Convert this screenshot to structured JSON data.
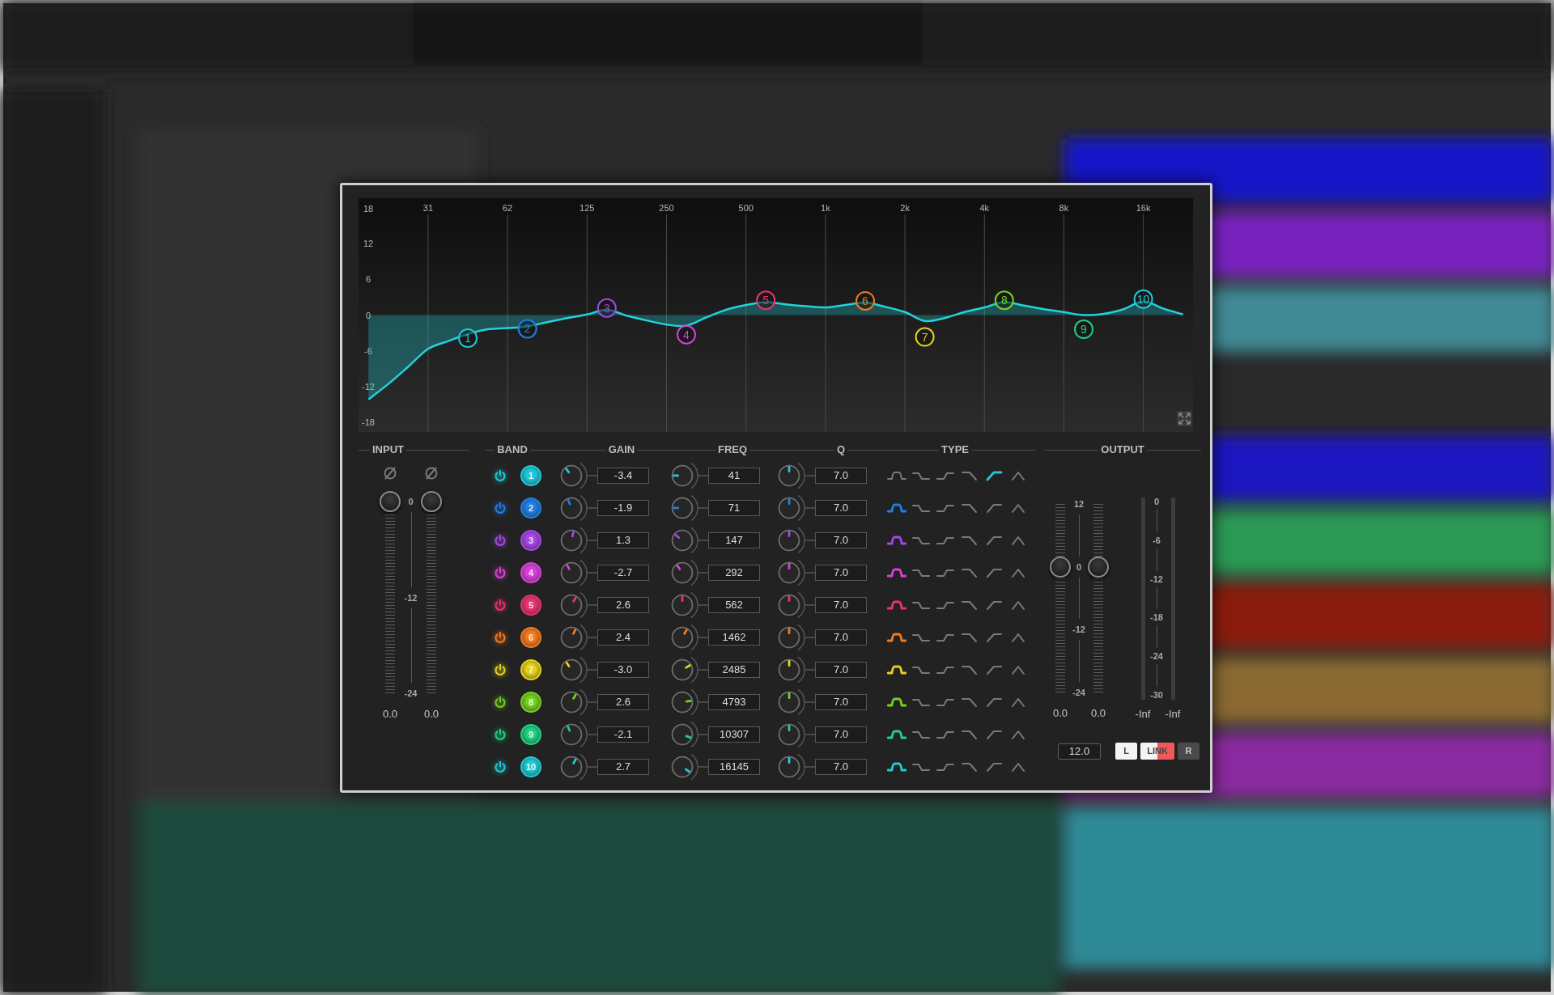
{
  "eq_graph": {
    "chart_data": {
      "type": "area",
      "grid": true,
      "categories": [
        null,
        null,
        null,
        "31",
        null,
        null,
        null,
        "62",
        null,
        null,
        null,
        "125",
        null,
        null,
        null,
        "250",
        null,
        null,
        null,
        "500",
        null,
        null,
        null,
        "1k",
        null,
        null,
        null,
        "2k",
        null,
        null,
        null,
        "4k",
        null,
        null,
        null,
        "8k",
        null,
        null,
        null,
        "16k",
        null,
        null
      ],
      "yticks": [
        18,
        12,
        6,
        0,
        -6,
        -12,
        -18
      ],
      "ylim": [
        -19.7,
        19.7
      ],
      "series": [
        {
          "color": "#22d3dc",
          "values": [
            -14.2,
            -11.6,
            -8.7,
            -5.7,
            -4.4,
            -3.2,
            -2.4,
            -2.2,
            -1.9,
            -1.2,
            -0.5,
            0.1,
            0.9,
            -0.1,
            -0.9,
            -1.6,
            -1.8,
            -0.4,
            0.9,
            1.7,
            2.2,
            1.8,
            1.5,
            1.3,
            1.7,
            2.1,
            1.4,
            0.5,
            -1.0,
            -0.5,
            0.5,
            1.3,
            2.2,
            1.6,
            1.0,
            0.5,
            0.0,
            0.2,
            1.0,
            2.3,
            1.1,
            0.1
          ]
        },
        {
          "type": "scatter",
          "values": [
            null,
            null,
            null,
            null,
            null,
            -3.9,
            null,
            null,
            -2.3,
            null,
            null,
            null,
            1.2,
            null,
            null,
            null,
            -3.3,
            null,
            null,
            null,
            2.5,
            null,
            null,
            null,
            null,
            2.4,
            null,
            null,
            -3.7,
            null,
            null,
            null,
            2.5,
            null,
            null,
            null,
            -2.4,
            null,
            null,
            2.7,
            null,
            null
          ]
        }
      ],
      "annotations": [
        "1",
        "2",
        "3",
        "4",
        "5",
        "6",
        "7",
        "8",
        "9",
        "10"
      ]
    }
  },
  "input": {
    "title": "INPUT",
    "scale": [
      "0",
      "-12",
      "-24"
    ],
    "channels": [
      {
        "level": 1,
        "reading": "0.0"
      },
      {
        "level": 1,
        "reading": "0.0"
      }
    ]
  },
  "band_columns": [
    "BAND",
    "GAIN",
    "FREQ",
    "Q",
    "TYPE"
  ],
  "bands": [
    {
      "enabled": true,
      "label": "1",
      "color": "#1fc8d8",
      "gain": {
        "value": "-3.4",
        "level": 0.36
      },
      "freq": {
        "value": "41",
        "level": 0.17
      },
      "q": {
        "value": "7.0",
        "level": 0.5
      },
      "types": [
        {
          "selected": false
        },
        {
          "selected": false
        },
        {
          "selected": false
        },
        {
          "selected": false
        },
        {
          "selected": true
        },
        {
          "selected": false
        }
      ]
    },
    {
      "enabled": true,
      "label": "2",
      "color": "#1f7fe6",
      "gain": {
        "value": "-1.9",
        "level": 0.42
      },
      "freq": {
        "value": "71",
        "level": 0.17
      },
      "q": {
        "value": "7.0",
        "level": 0.5
      },
      "types": [
        {
          "selected": true
        },
        {
          "selected": false
        },
        {
          "selected": false
        },
        {
          "selected": false
        },
        {
          "selected": false
        },
        {
          "selected": false
        }
      ]
    },
    {
      "enabled": true,
      "label": "3",
      "color": "#a546e6",
      "gain": {
        "value": "1.3",
        "level": 0.55
      },
      "freq": {
        "value": "147",
        "level": 0.31
      },
      "q": {
        "value": "7.0",
        "level": 0.5
      },
      "types": [
        {
          "selected": true
        },
        {
          "selected": false
        },
        {
          "selected": false
        },
        {
          "selected": false
        },
        {
          "selected": false
        },
        {
          "selected": false
        }
      ]
    },
    {
      "enabled": true,
      "label": "4",
      "color": "#d940d9",
      "gain": {
        "value": "-2.7",
        "level": 0.39
      },
      "freq": {
        "value": "292",
        "level": 0.37
      },
      "q": {
        "value": "7.0",
        "level": 0.5
      },
      "types": [
        {
          "selected": true
        },
        {
          "selected": false
        },
        {
          "selected": false
        },
        {
          "selected": false
        },
        {
          "selected": false
        },
        {
          "selected": false
        }
      ]
    },
    {
      "enabled": true,
      "label": "5",
      "color": "#e8336e",
      "gain": {
        "value": "2.6",
        "level": 0.61
      },
      "freq": {
        "value": "562",
        "level": 0.5
      },
      "q": {
        "value": "7.0",
        "level": 0.5
      },
      "types": [
        {
          "selected": true
        },
        {
          "selected": false
        },
        {
          "selected": false
        },
        {
          "selected": false
        },
        {
          "selected": false
        },
        {
          "selected": false
        }
      ]
    },
    {
      "enabled": true,
      "label": "6",
      "color": "#f27a20",
      "gain": {
        "value": "2.4",
        "level": 0.6
      },
      "freq": {
        "value": "1462",
        "level": 0.61
      },
      "q": {
        "value": "7.0",
        "level": 0.5
      },
      "types": [
        {
          "selected": true
        },
        {
          "selected": false
        },
        {
          "selected": false
        },
        {
          "selected": false
        },
        {
          "selected": false
        },
        {
          "selected": false
        }
      ]
    },
    {
      "enabled": true,
      "label": "7",
      "color": "#e6d21e",
      "gain": {
        "value": "-3.0",
        "level": 0.375
      },
      "freq": {
        "value": "2485",
        "level": 0.72
      },
      "q": {
        "value": "7.0",
        "level": 0.5
      },
      "types": [
        {
          "selected": true
        },
        {
          "selected": false
        },
        {
          "selected": false
        },
        {
          "selected": false
        },
        {
          "selected": false
        },
        {
          "selected": false
        }
      ]
    },
    {
      "enabled": true,
      "label": "8",
      "color": "#74d11f",
      "gain": {
        "value": "2.6",
        "level": 0.61
      },
      "freq": {
        "value": "4793",
        "level": 0.8
      },
      "q": {
        "value": "7.0",
        "level": 0.5
      },
      "types": [
        {
          "selected": true
        },
        {
          "selected": false
        },
        {
          "selected": false
        },
        {
          "selected": false
        },
        {
          "selected": false
        },
        {
          "selected": false
        }
      ]
    },
    {
      "enabled": true,
      "label": "9",
      "color": "#1fd184",
      "gain": {
        "value": "-2.1",
        "level": 0.41
      },
      "freq": {
        "value": "10307",
        "level": 0.91
      },
      "q": {
        "value": "7.0",
        "level": 0.5
      },
      "types": [
        {
          "selected": true
        },
        {
          "selected": false
        },
        {
          "selected": false
        },
        {
          "selected": false
        },
        {
          "selected": false
        },
        {
          "selected": false
        }
      ]
    },
    {
      "enabled": true,
      "label": "10",
      "color": "#1fcbd6",
      "gain": {
        "value": "2.7",
        "level": 0.61
      },
      "freq": {
        "value": "16145",
        "level": 0.96
      },
      "q": {
        "value": "7.0",
        "level": 0.5
      },
      "types": [
        {
          "selected": true
        },
        {
          "selected": false
        },
        {
          "selected": false
        },
        {
          "selected": false
        },
        {
          "selected": false
        },
        {
          "selected": false
        }
      ]
    }
  ],
  "output": {
    "title": "OUTPUT",
    "scale": [
      "12",
      "0",
      "-12",
      "-24"
    ],
    "faders": [
      {
        "level": 0.667,
        "reading": "0.0"
      },
      {
        "level": 0.667,
        "reading": "0.0"
      }
    ],
    "meter_scale": [
      "0",
      "-6",
      "-12",
      "-18",
      "-24",
      "-30"
    ],
    "meters": [
      {
        "reading": "-Inf"
      },
      {
        "reading": "-Inf"
      }
    ],
    "range_field": "12.0",
    "channel_buttons": [
      {
        "kind": "channel",
        "label": "L",
        "selected": true
      },
      {
        "kind": "link",
        "label": "LINK",
        "selected": true
      },
      {
        "kind": "channel",
        "label": "R",
        "selected": false
      }
    ]
  }
}
